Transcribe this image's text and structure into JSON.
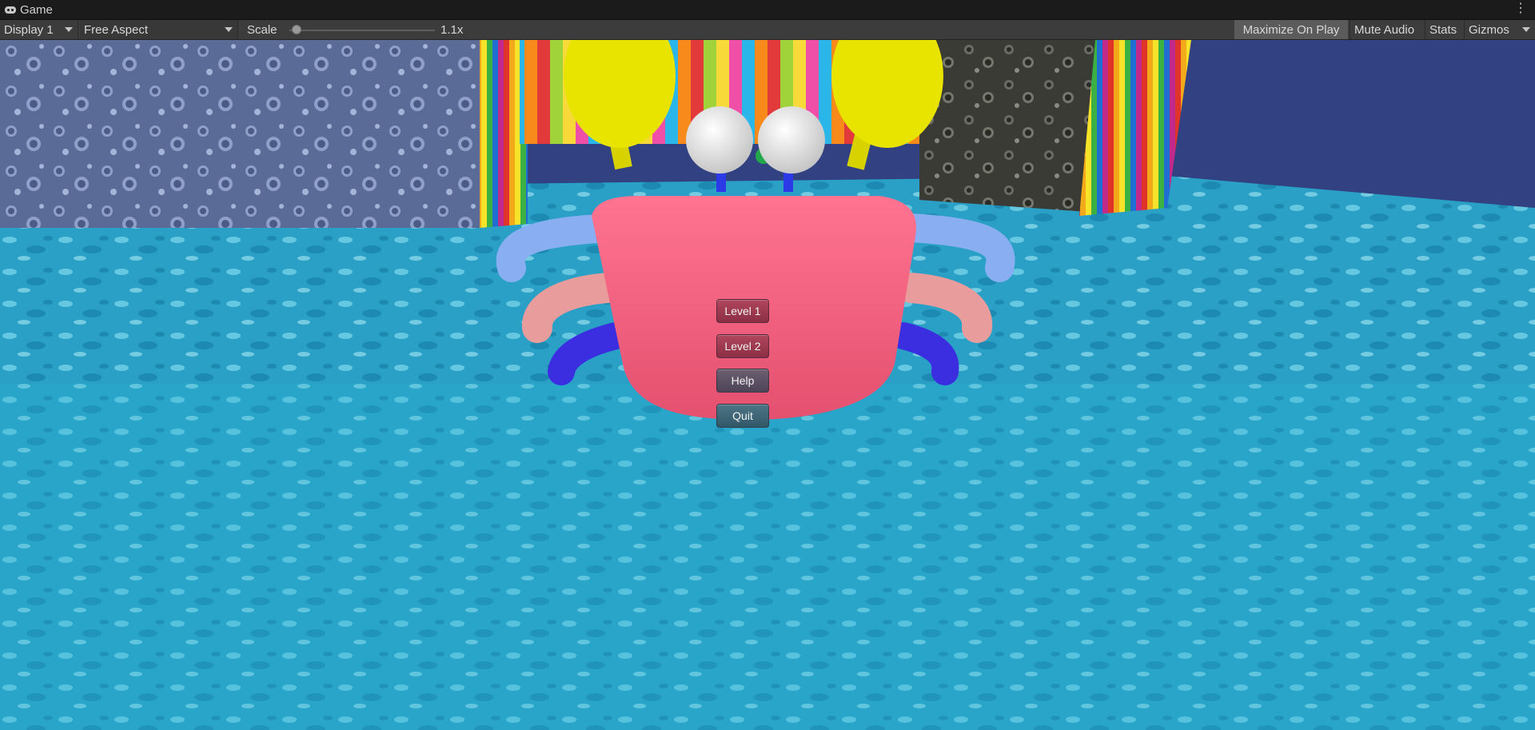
{
  "window": {
    "tab_label": "Game",
    "tab_icon": "gamepad-icon"
  },
  "toolbar": {
    "display": "Display 1",
    "aspect": "Free Aspect",
    "scale_label": "Scale",
    "scale_value": "1.1x",
    "maximize_on_play": "Maximize On Play",
    "mute_audio": "Mute Audio",
    "stats": "Stats",
    "gizmos": "Gizmos"
  },
  "menu": {
    "level1": "Level 1",
    "level2": "Level 2",
    "help": "Help",
    "quit": "Quit"
  },
  "colors": {
    "editor_bg": "#3c3c3c",
    "water": "#2aa3c8",
    "crab_body": "#f0607e",
    "crab_claws": "#e8e000",
    "button_level": "#a03c52",
    "button_quit": "#3f6a7c"
  }
}
